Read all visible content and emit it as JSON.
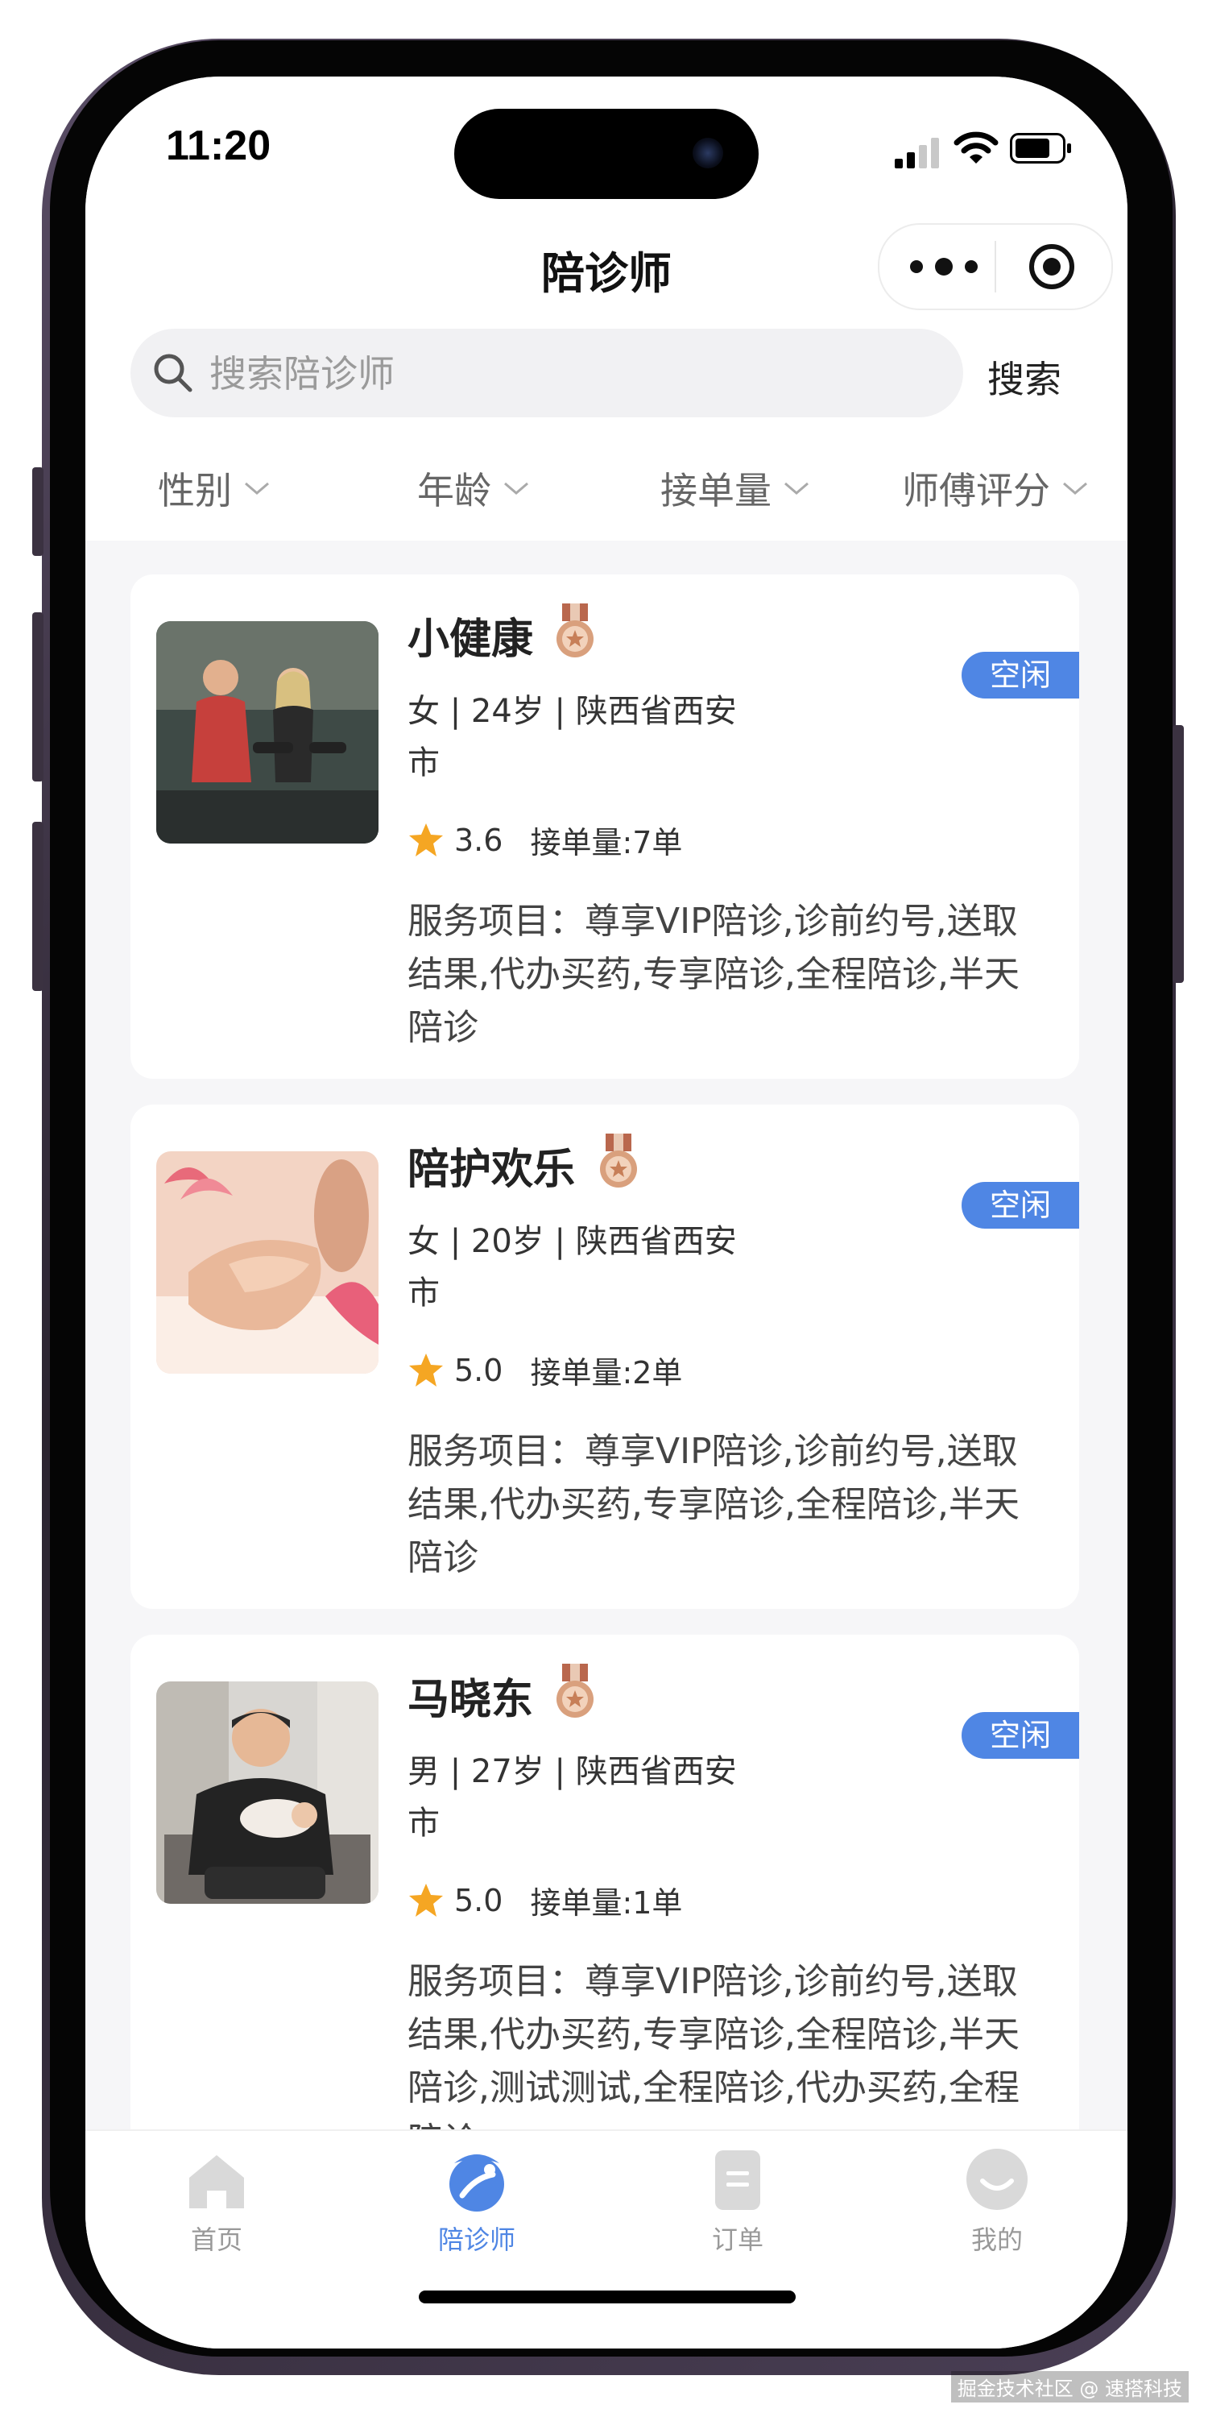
{
  "status_bar": {
    "time": "11:20"
  },
  "header": {
    "title": "陪诊师"
  },
  "search": {
    "placeholder": "搜索陪诊师",
    "value": "",
    "button_label": "搜索"
  },
  "filters": [
    {
      "label": "性别"
    },
    {
      "label": "年龄"
    },
    {
      "label": "接单量"
    },
    {
      "label": "师傅评分"
    }
  ],
  "escorts": [
    {
      "name": "小健康",
      "status": "空闲",
      "info": "女 | 24岁 | 陕西省西安市",
      "rating": "3.6",
      "orders": "接单量:7单",
      "services": "服务项目：尊享VIP陪诊,诊前约号,送取结果,代办买药,专享陪诊,全程陪诊,半天陪诊"
    },
    {
      "name": "陪护欢乐",
      "status": "空闲",
      "info": "女 | 20岁 | 陕西省西安市",
      "rating": "5.0",
      "orders": "接单量:2单",
      "services": "服务项目：尊享VIP陪诊,诊前约号,送取结果,代办买药,专享陪诊,全程陪诊,半天陪诊"
    },
    {
      "name": "马晓东",
      "status": "空闲",
      "info": "男 | 27岁 | 陕西省西安市",
      "rating": "5.0",
      "orders": "接单量:1单",
      "services": "服务项目：尊享VIP陪诊,诊前约号,送取结果,代办买药,专享陪诊,全程陪诊,半天陪诊,测试测试,全程陪诊,代办买药,全程陪诊"
    }
  ],
  "tabbar": [
    {
      "label": "首页",
      "icon": "home-icon"
    },
    {
      "label": "陪诊师",
      "icon": "escort-icon"
    },
    {
      "label": "订单",
      "icon": "order-icon"
    },
    {
      "label": "我的",
      "icon": "profile-icon"
    }
  ],
  "colors": {
    "accent": "#4f86e4",
    "star": "#f5a623",
    "background": "#f6f6f8"
  },
  "watermark": "掘金技术社区 @ 速搭科技"
}
